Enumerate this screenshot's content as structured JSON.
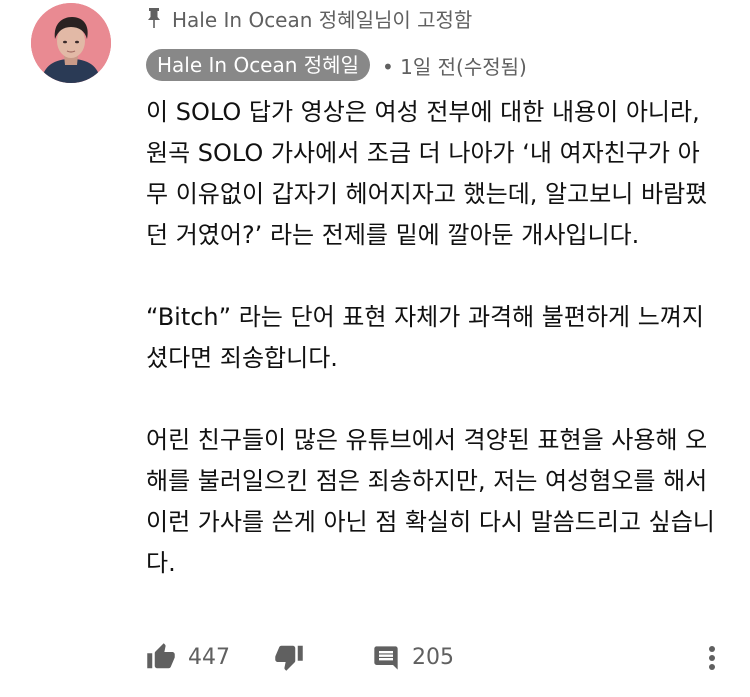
{
  "pin": {
    "icon": "pin-icon",
    "text": "Hale In Ocean 정혜일님이 고정함"
  },
  "author": {
    "name": "Hale In Ocean 정혜일",
    "meta": "• 1일 전(수정됨)"
  },
  "comment": {
    "paragraphs": [
      "이 SOLO 답가 영상은 여성 전부에 대한 내용이 아니라, 원곡 SOLO 가사에서 조금 더 나아가 ‘내 여자친구가 아무 이유없이 갑자기 헤어지자고 했는데, 알고보니 바람폈던 거였어?’ 라는 전제를 밑에 깔아둔 개사입니다.",
      "“Bitch” 라는 단어 표현 자체가 과격해 불편하게 느껴지셨다면 죄송합니다.",
      "어린 친구들이 많은 유튜브에서 격양된 표현을 사용해 오해를 불러일으킨 점은 죄송하지만, 저는 여성혐오를 해서 이런 가사를 쓴게 아닌 점 확실히 다시 말씀드리고 싶습니다."
    ]
  },
  "actions": {
    "like_count": "447",
    "reply_count": "205",
    "icons": [
      "thumb-up-icon",
      "thumb-down-icon",
      "reply-icon",
      "more-vertical-icon"
    ]
  },
  "colors": {
    "chip_bg": "#888888",
    "meta_text": "#606060",
    "body_text": "#111111",
    "icon": "#606060"
  }
}
